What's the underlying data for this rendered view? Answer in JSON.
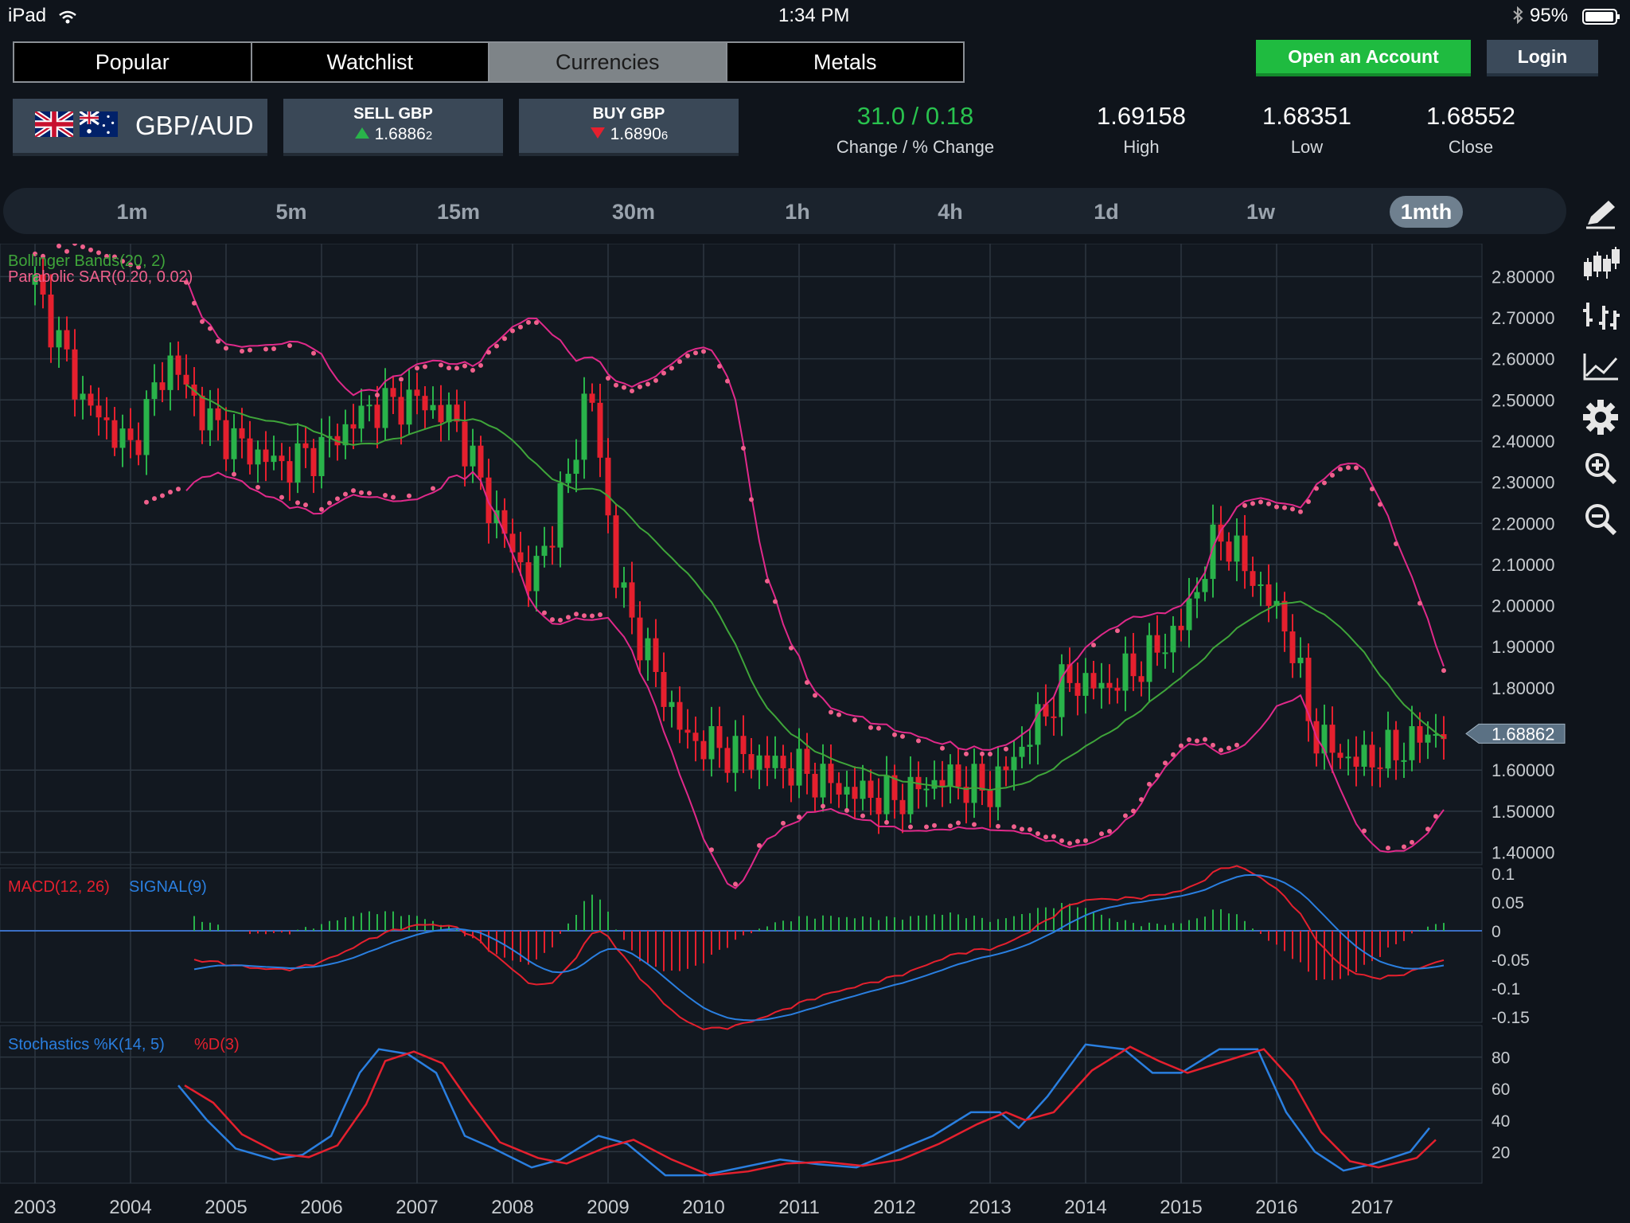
{
  "status_bar": {
    "device": "iPad",
    "time": "1:34 PM",
    "battery": "95%"
  },
  "nav_tabs": [
    {
      "label": "Popular",
      "active": false
    },
    {
      "label": "Watchlist",
      "active": false
    },
    {
      "label": "Currencies",
      "active": true
    },
    {
      "label": "Metals",
      "active": false
    }
  ],
  "account": {
    "open_label": "Open an Account",
    "login_label": "Login"
  },
  "instrument": {
    "pair": "GBP/AUD",
    "flags": [
      "gb-flag-icon",
      "au-flag-icon"
    ]
  },
  "sell": {
    "label": "SELL GBP",
    "price_main": "1.6886",
    "price_small": "2",
    "direction": "up"
  },
  "buy": {
    "label": "BUY GBP",
    "price_main": "1.6890",
    "price_small": "6",
    "direction": "down"
  },
  "stats": {
    "change": {
      "value": "31.0 / 0.18",
      "label": "Change / % Change"
    },
    "high": {
      "value": "1.69158",
      "label": "High"
    },
    "low": {
      "value": "1.68351",
      "label": "Low"
    },
    "close": {
      "value": "1.68552",
      "label": "Close"
    }
  },
  "timeframes": [
    "1m",
    "5m",
    "15m",
    "30m",
    "1h",
    "4h",
    "1d",
    "1w",
    "1mth"
  ],
  "active_timeframe": "1mth",
  "toolbar_icons": [
    "pencil-icon",
    "candlestick-icon",
    "bar-chart-icon",
    "line-chart-icon",
    "settings-gear-icon",
    "zoom-in-icon",
    "zoom-out-icon"
  ],
  "colors": {
    "up": "#29b34a",
    "down": "#e5202e",
    "bollinger": "#e0298a",
    "sar": "#f0608c",
    "ma": "#3fa53a",
    "macd": "#e5202e",
    "signal": "#2a7fe0",
    "stoch_k": "#2a7fe0",
    "stoch_d": "#e5202e"
  },
  "chart_data": [
    {
      "type": "candlestick",
      "title": "",
      "indicators_legend": [
        "Bollinger Bands(20, 2)",
        "Parabolic SAR(0.20, 0.02)"
      ],
      "x_ticks": [
        "2003",
        "2004",
        "2005",
        "2006",
        "2007",
        "2008",
        "2009",
        "2010",
        "2011",
        "2012",
        "2013",
        "2014",
        "2015",
        "2016",
        "2017"
      ],
      "y_ticks": [
        "2.80000",
        "2.70000",
        "2.60000",
        "2.50000",
        "2.40000",
        "2.30000",
        "2.20000",
        "2.10000",
        "2.00000",
        "1.90000",
        "1.80000",
        "1.60000",
        "1.50000",
        "1.40000"
      ],
      "ylim": [
        1.37,
        2.88
      ],
      "current_price": "1.68862",
      "close_by_year": {
        "x": [
          2003.0,
          2003.5,
          2004.0,
          2004.4,
          2004.8,
          2005.2,
          2005.6,
          2006.0,
          2006.5,
          2007.0,
          2007.4,
          2007.8,
          2008.2,
          2008.6,
          2008.8,
          2009.1,
          2009.5,
          2009.8,
          2010.2,
          2010.6,
          2011.0,
          2011.5,
          2012.0,
          2012.5,
          2013.0,
          2013.4,
          2013.8,
          2014.2,
          2014.6,
          2015.0,
          2015.4,
          2015.8,
          2016.1,
          2016.4,
          2016.8,
          2017.2,
          2017.6
        ],
        "y": [
          2.78,
          2.5,
          2.38,
          2.6,
          2.45,
          2.38,
          2.34,
          2.38,
          2.48,
          2.5,
          2.45,
          2.22,
          2.05,
          2.32,
          2.55,
          2.05,
          1.83,
          1.68,
          1.65,
          1.62,
          1.6,
          1.55,
          1.53,
          1.58,
          1.55,
          1.68,
          1.82,
          1.8,
          1.86,
          1.95,
          2.18,
          2.05,
          1.95,
          1.68,
          1.62,
          1.64,
          1.69
        ]
      }
    },
    {
      "type": "line",
      "title": "",
      "legend": [
        "MACD(12, 26)",
        "SIGNAL(9)"
      ],
      "y_ticks": [
        "0.1",
        "0.05",
        "0",
        "-0.05",
        "-0.1",
        "-0.15"
      ],
      "ylim": [
        -0.16,
        0.11
      ]
    },
    {
      "type": "line",
      "title": "",
      "legend": [
        "Stochastics %K(14, 5)",
        "%D(3)"
      ],
      "y_ticks": [
        "80",
        "60",
        "40",
        "20"
      ],
      "ylim": [
        0,
        100
      ],
      "k": {
        "x": [
          2004.5,
          2004.8,
          2005.1,
          2005.5,
          2005.8,
          2006.1,
          2006.4,
          2006.6,
          2006.9,
          2007.2,
          2007.5,
          2007.8,
          2008.2,
          2008.5,
          2008.9,
          2009.2,
          2009.6,
          2010.0,
          2010.4,
          2010.8,
          2011.2,
          2011.6,
          2012.0,
          2012.4,
          2012.8,
          2013.1,
          2013.3,
          2013.6,
          2014.0,
          2014.4,
          2014.7,
          2015.0,
          2015.4,
          2015.8,
          2016.1,
          2016.4,
          2016.7,
          2017.0,
          2017.4,
          2017.6
        ],
        "y": [
          62,
          40,
          22,
          15,
          18,
          30,
          70,
          85,
          82,
          70,
          30,
          22,
          10,
          15,
          30,
          25,
          5,
          5,
          10,
          15,
          12,
          10,
          20,
          30,
          45,
          45,
          35,
          55,
          88,
          85,
          70,
          70,
          85,
          85,
          45,
          20,
          8,
          12,
          20,
          35
        ]
      }
    }
  ]
}
